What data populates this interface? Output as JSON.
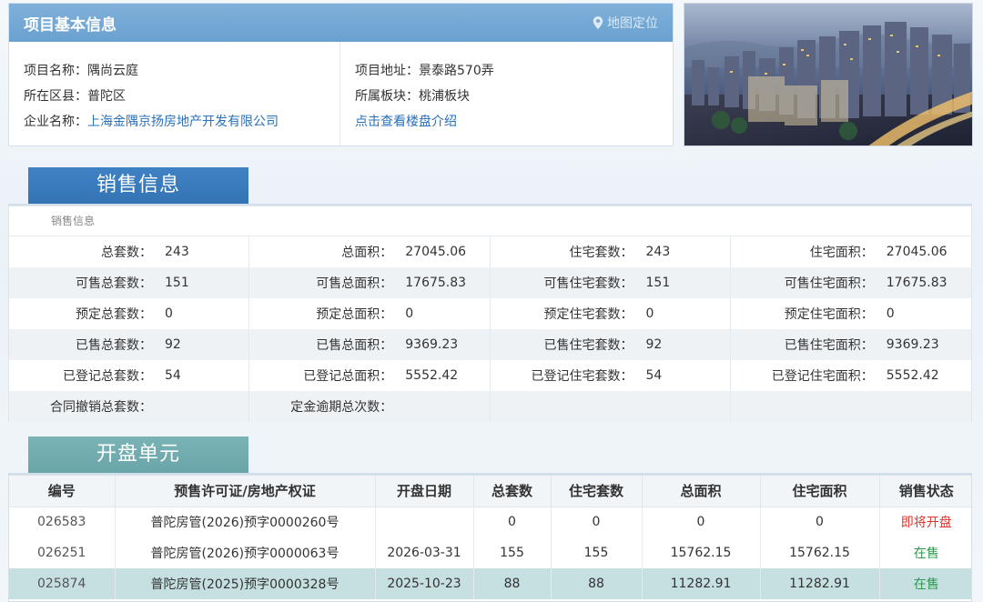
{
  "project_info": {
    "title": "项目基本信息",
    "map_link": "地图定位",
    "left": [
      {
        "label": "项目名称：",
        "value": "隅尚云庭",
        "link": false
      },
      {
        "label": "所在区县：",
        "value": "普陀区",
        "link": false
      },
      {
        "label": "企业名称：",
        "value": "上海金隅京扬房地产开发有限公司",
        "link": true
      }
    ],
    "right": [
      {
        "label": "项目地址：",
        "value": "景泰路570弄"
      },
      {
        "label": "所属板块：",
        "value": "桃浦板块"
      },
      {
        "label": "",
        "value": "点击查看楼盘介绍"
      }
    ]
  },
  "sales_info": {
    "tab": "销售信息",
    "subtitle": "销售信息",
    "rows": [
      [
        [
          "总套数：",
          "243"
        ],
        [
          "总面积：",
          "27045.06"
        ],
        [
          "住宅套数：",
          "243"
        ],
        [
          "住宅面积：",
          "27045.06"
        ]
      ],
      [
        [
          "可售总套数：",
          "151"
        ],
        [
          "可售总面积：",
          "17675.83"
        ],
        [
          "可售住宅套数：",
          "151"
        ],
        [
          "可售住宅面积：",
          "17675.83"
        ]
      ],
      [
        [
          "预定总套数：",
          "0"
        ],
        [
          "预定总面积：",
          "0"
        ],
        [
          "预定住宅套数：",
          "0"
        ],
        [
          "预定住宅面积：",
          "0"
        ]
      ],
      [
        [
          "已售总套数：",
          "92"
        ],
        [
          "已售总面积：",
          "9369.23"
        ],
        [
          "已售住宅套数：",
          "92"
        ],
        [
          "已售住宅面积：",
          "9369.23"
        ]
      ],
      [
        [
          "已登记总套数：",
          "54"
        ],
        [
          "已登记总面积：",
          "5552.42"
        ],
        [
          "已登记住宅套数：",
          "54"
        ],
        [
          "已登记住宅面积：",
          "5552.42"
        ]
      ],
      [
        [
          "合同撤销总套数：",
          ""
        ],
        [
          "定金逾期总次数：",
          ""
        ],
        [
          "",
          ""
        ],
        [
          "",
          ""
        ]
      ]
    ]
  },
  "units": {
    "tab": "开盘单元",
    "headers": [
      "编号",
      "预售许可证/房地产权证",
      "开盘日期",
      "总套数",
      "住宅套数",
      "总面积",
      "住宅面积",
      "销售状态"
    ],
    "rows": [
      {
        "cells": [
          "026583",
          "普陀房管(2026)预字0000260号",
          "",
          "0",
          "0",
          "0",
          "0"
        ],
        "status": "即将开盘",
        "status_color": "#e0342f"
      },
      {
        "cells": [
          "026251",
          "普陀房管(2026)预字0000063号",
          "2026-03-31",
          "155",
          "155",
          "15762.15",
          "15762.15"
        ],
        "status": "在售",
        "status_color": "#2a9a4a"
      },
      {
        "cells": [
          "025874",
          "普陀房管(2025)预字0000328号",
          "2025-10-23",
          "88",
          "88",
          "11282.91",
          "11282.91"
        ],
        "status": "在售",
        "status_color": "#2a9a4a"
      }
    ]
  },
  "colors": {
    "header_blue": "#6aa1d0",
    "tab_blue": "#3474b4",
    "tab_teal": "#6aa5a9",
    "link_blue": "#2a6fb8",
    "row_highlight": "#c6e0e2"
  }
}
